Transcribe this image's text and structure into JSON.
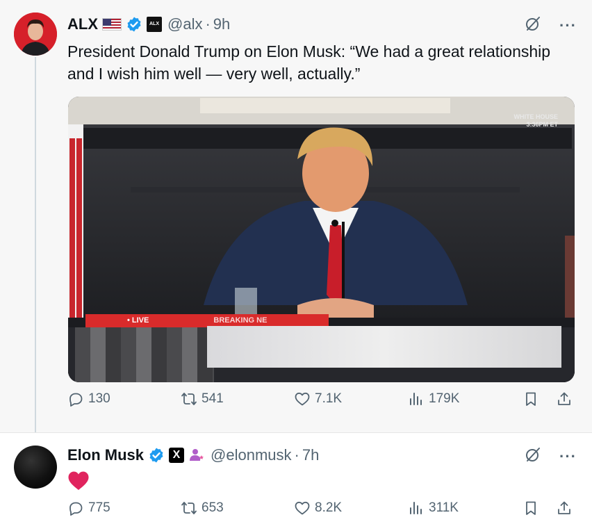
{
  "tweet1": {
    "author_name": "ALX",
    "affiliate_label": "ALX",
    "handle": "@alx",
    "time": "9h",
    "dot": "·",
    "text": "President Donald Trump on Elon Musk: “We had a great relationship and I wish him well — very well, actually.”",
    "media": {
      "bug_line1": "WHITE HOUSE",
      "bug_line2": "3:36PM ET",
      "live_label": "• LIVE",
      "breaking_label": "BREAKING NE"
    },
    "actions": {
      "replies": "130",
      "reposts": "541",
      "likes": "7.1K",
      "views": "179K"
    }
  },
  "tweet2": {
    "author_name": "Elon Musk",
    "x_badge": "X",
    "handle": "@elonmusk",
    "time": "7h",
    "dot": "·",
    "actions": {
      "replies": "775",
      "reposts": "653",
      "likes": "8.2K",
      "views": "311K"
    }
  },
  "more_label": "···",
  "colors": {
    "verified_blue": "#1d9bf0",
    "heart_red": "#e0245e",
    "secondary_text": "#536471",
    "live_red": "#d92b2b"
  },
  "icons": [
    "grok-icon",
    "more-icon",
    "reply-icon",
    "retweet-icon",
    "like-icon",
    "views-icon",
    "bookmark-icon",
    "share-icon",
    "verified-icon",
    "us-flag-icon",
    "heart-emoji"
  ]
}
